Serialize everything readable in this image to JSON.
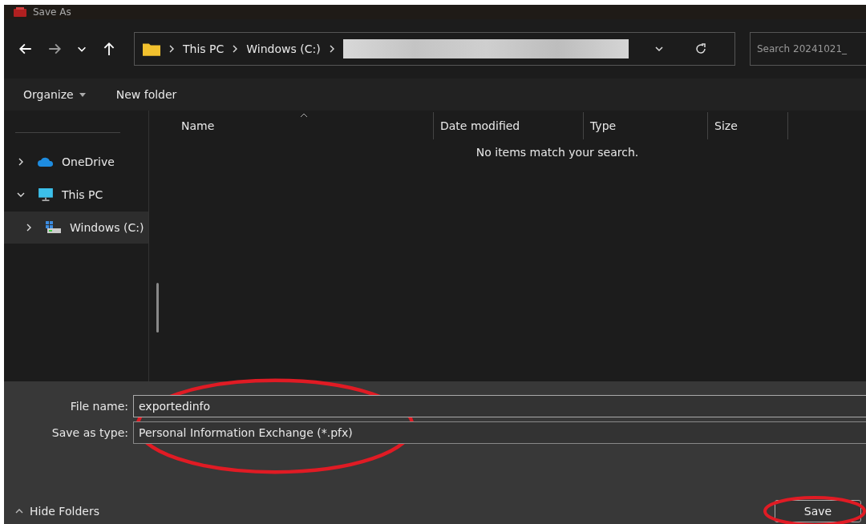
{
  "window": {
    "title": "Save As"
  },
  "address_bar": {
    "crumbs": [
      "This PC",
      "Windows (C:)"
    ]
  },
  "search": {
    "placeholder": "Search 20241021_"
  },
  "toolbar": {
    "organize": "Organize",
    "new_folder": "New folder"
  },
  "sidebar": {
    "items": [
      {
        "label": "OneDrive",
        "kind": "cloud",
        "expanded": false,
        "selected": false
      },
      {
        "label": "This PC",
        "kind": "pc",
        "expanded": true,
        "selected": false,
        "children": [
          {
            "label": "Windows (C:)",
            "kind": "drive",
            "expanded": false,
            "selected": true
          }
        ]
      }
    ]
  },
  "table": {
    "columns": [
      "Name",
      "Date modified",
      "Type",
      "Size"
    ],
    "empty_message": "No items match your search."
  },
  "form": {
    "file_name_label": "File name:",
    "file_name": "exportedinfo",
    "type_label": "Save as type:",
    "type_value": "Personal Information Exchange (*.pfx)"
  },
  "footer": {
    "hide_folders": "Hide Folders",
    "save": "Save"
  }
}
